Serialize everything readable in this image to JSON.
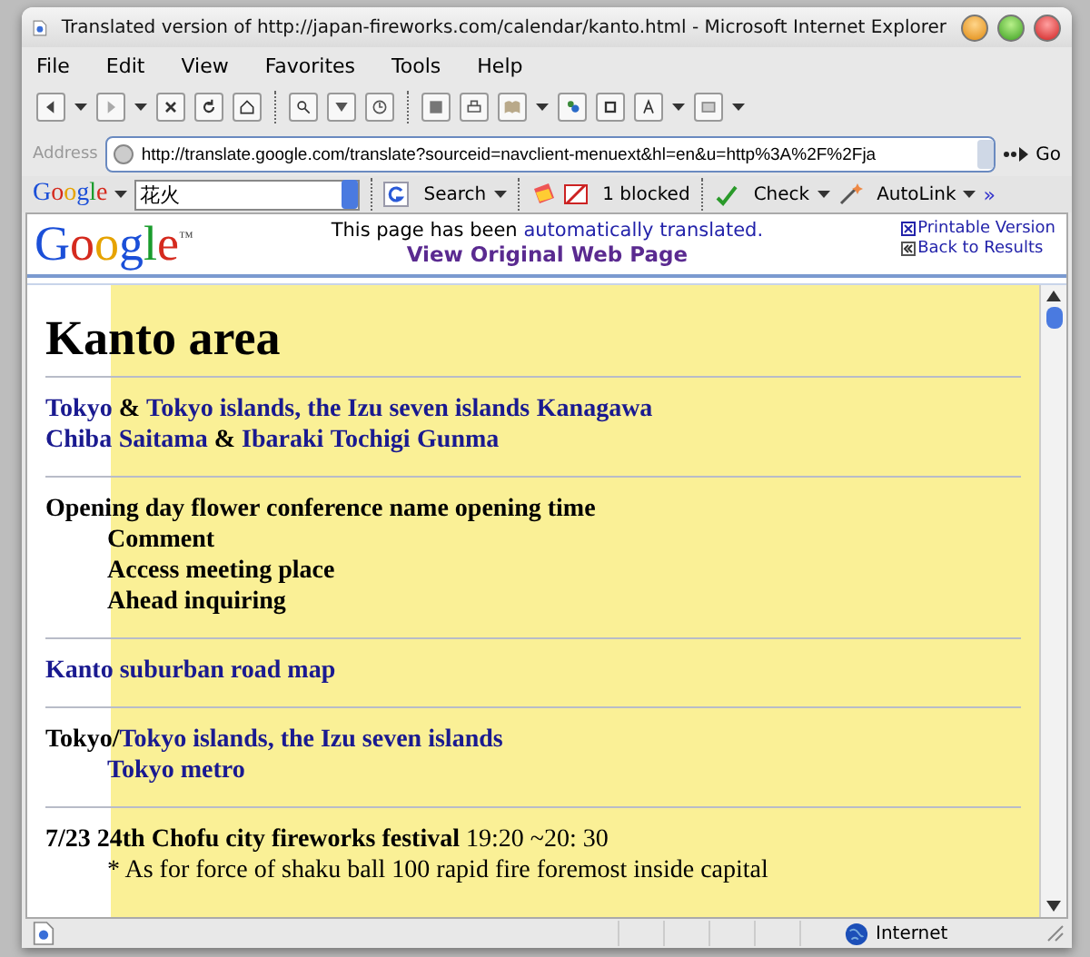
{
  "window": {
    "title": "Translated version of http://japan-fireworks.com/calendar/kanto.html - Microsoft Internet Explorer"
  },
  "menu": [
    {
      "label": "File"
    },
    {
      "label": "Edit"
    },
    {
      "label": "View"
    },
    {
      "label": "Favorites"
    },
    {
      "label": "Tools"
    },
    {
      "label": "Help"
    }
  ],
  "address": {
    "label": "Address",
    "value": "http://translate.google.com/translate?sourceid=navclient-menuext&hl=en&u=http%3A%2F%2Fja",
    "go": "Go"
  },
  "google_toolbar": {
    "logo": "Google",
    "query": "花火",
    "search": "Search",
    "blocked": "1 blocked",
    "check": "Check",
    "autolink": "AutoLink",
    "more": "»"
  },
  "translate_bar": {
    "logo": "Google",
    "trademark": "™",
    "notice": "This page has been ",
    "notice_link": "automatically translated.",
    "original_link": "View Original Web Page",
    "printable": "Printable Version",
    "back": "Back to Results"
  },
  "page": {
    "heading": "Kanto area",
    "blocks": [
      {
        "lines": [
          {
            "indent": false,
            "segments": [
              {
                "kind": "link",
                "text": "Tokyo"
              },
              {
                "kind": "bold",
                "text": " & "
              },
              {
                "kind": "link",
                "text": "Tokyo islands, the Izu seven islands",
                "space_after": true
              },
              {
                "kind": "link",
                "text": "Kanagawa"
              }
            ]
          },
          {
            "indent": false,
            "segments": [
              {
                "kind": "link",
                "text": "Chiba",
                "space_after": true
              },
              {
                "kind": "link",
                "text": "Saitama"
              },
              {
                "kind": "bold",
                "text": " & "
              },
              {
                "kind": "link",
                "text": "Ibaraki",
                "space_after": true
              },
              {
                "kind": "link",
                "text": "Tochigi",
                "space_after": true
              },
              {
                "kind": "link",
                "text": "Gunma"
              }
            ]
          }
        ]
      },
      {
        "lines": [
          {
            "indent": false,
            "segments": [
              {
                "kind": "bold",
                "text": "Opening day flower conference name opening time"
              }
            ]
          },
          {
            "indent": true,
            "segments": [
              {
                "kind": "bold",
                "text": "Comment"
              }
            ]
          },
          {
            "indent": true,
            "segments": [
              {
                "kind": "bold",
                "text": "Access meeting place"
              }
            ]
          },
          {
            "indent": true,
            "segments": [
              {
                "kind": "bold",
                "text": "Ahead inquiring"
              }
            ]
          }
        ]
      },
      {
        "lines": [
          {
            "indent": false,
            "segments": [
              {
                "kind": "link",
                "text": "Kanto suburban road map"
              }
            ]
          }
        ]
      },
      {
        "lines": [
          {
            "indent": false,
            "segments": [
              {
                "kind": "bold",
                "text": "Tokyo/"
              },
              {
                "kind": "link",
                "text": "Tokyo islands, the Izu seven islands"
              }
            ]
          },
          {
            "indent": true,
            "segments": [
              {
                "kind": "link",
                "text": "Tokyo metro"
              }
            ]
          }
        ]
      },
      {
        "lines": [
          {
            "indent": false,
            "segments": [
              {
                "kind": "bold",
                "text": "7/23 24th Chofu city fireworks festival"
              },
              {
                "kind": "plain",
                "text": " 19:20 ~20: 30"
              }
            ]
          },
          {
            "indent": true,
            "segments": [
              {
                "kind": "plain",
                "text": "* As for force of shaku ball 100 rapid fire foremost inside capital"
              }
            ]
          }
        ]
      }
    ]
  },
  "status_bar": {
    "zone": "Internet"
  }
}
